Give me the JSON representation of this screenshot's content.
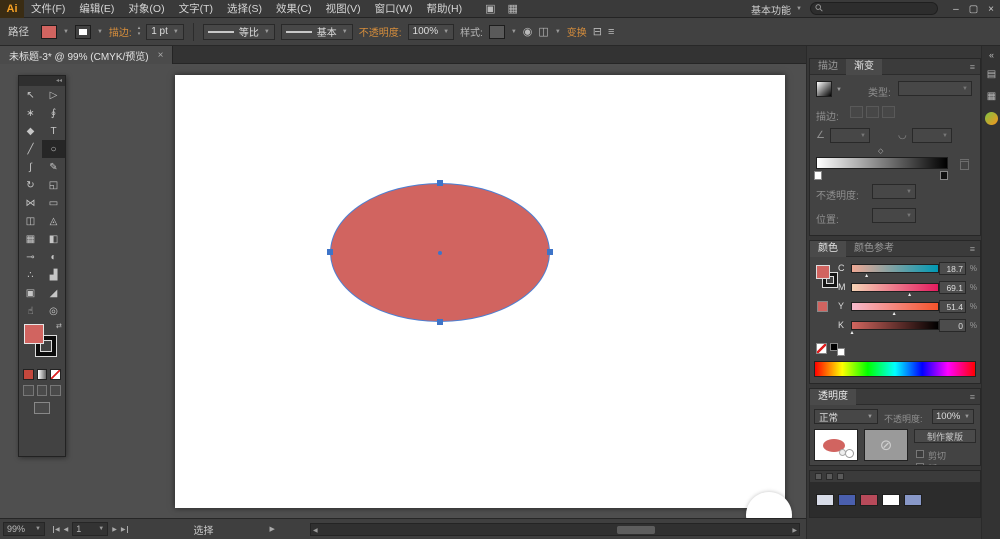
{
  "colors": {
    "accent": "#d78e3c",
    "canvas_gray": "#4f4f4f"
  },
  "canvas": {
    "ellipse": {
      "fill": "#d16460",
      "stroke": "#4d7fd2"
    }
  },
  "ui": {
    "caret": "▼",
    "caret_up": "▴",
    "caret_down": "▾",
    "collapse": "◂◂",
    "expand": "«",
    "panel_menu": "≡",
    "arrow_left": "◀",
    "arrow_right": "▶",
    "swap": "⇄",
    "diamond": "◇",
    "blocked": "⊘"
  },
  "menubar": {
    "logo": "Ai",
    "menus": [
      "文件(F)",
      "编辑(E)",
      "对象(O)",
      "文字(T)",
      "选择(S)",
      "效果(C)",
      "视图(V)",
      "窗口(W)",
      "帮助(H)"
    ],
    "app_icons": [
      {
        "name": "bridge-icon",
        "glyph": "▣"
      },
      {
        "name": "arrange-documents-icon",
        "glyph": "▦"
      }
    ],
    "workspace_label": "基本功能",
    "search_icon": "⚲",
    "window_controls": [
      {
        "name": "minimize-button",
        "glyph": "–"
      },
      {
        "name": "restore-button",
        "glyph": "▢"
      },
      {
        "name": "close-button",
        "glyph": "×"
      }
    ]
  },
  "controlbar": {
    "object_type": "路径",
    "stroke_label": "描边:",
    "stroke_width": "1 pt",
    "width_profile_label": "等比",
    "brush_label": "基本",
    "opacity_label": "不透明度:",
    "opacity_value": "100%",
    "style_label": "样式:",
    "transform_label": "变换",
    "icons": [
      {
        "name": "recolor-artwork-icon",
        "glyph": "◉"
      },
      {
        "name": "align-icon",
        "glyph": "◫"
      },
      {
        "name": "arrange-icon",
        "glyph": "⊟"
      },
      {
        "name": "options-icon",
        "glyph": "≡"
      }
    ]
  },
  "tabbar": {
    "title": "未标题-3* @ 99% (CMYK/预览)",
    "close_icon": "×"
  },
  "toolbar": {
    "tools": [
      {
        "name": "selection-tool",
        "glyph": "↖"
      },
      {
        "name": "direct-selection-tool",
        "glyph": "▷"
      },
      {
        "name": "magic-wand-tool",
        "glyph": "∗"
      },
      {
        "name": "lasso-tool",
        "glyph": "∮"
      },
      {
        "name": "pen-tool",
        "glyph": "◆"
      },
      {
        "name": "type-tool",
        "glyph": "T"
      },
      {
        "name": "line-tool",
        "glyph": "╱"
      },
      {
        "name": "ellipse-tool",
        "glyph": "○",
        "bg": "#262626"
      },
      {
        "name": "paintbrush-tool",
        "glyph": "∫"
      },
      {
        "name": "pencil-tool",
        "glyph": "✎"
      },
      {
        "name": "rotate-tool",
        "glyph": "↻"
      },
      {
        "name": "scale-tool",
        "glyph": "◱"
      },
      {
        "name": "width-tool",
        "glyph": "⋈"
      },
      {
        "name": "free-transform-tool",
        "glyph": "▭"
      },
      {
        "name": "shape-builder-tool",
        "glyph": "◫"
      },
      {
        "name": "perspective-grid-tool",
        "glyph": "◬"
      },
      {
        "name": "mesh-tool",
        "glyph": "▦"
      },
      {
        "name": "gradient-tool",
        "glyph": "◧"
      },
      {
        "name": "eyedropper-tool",
        "glyph": "⊸"
      },
      {
        "name": "blend-tool",
        "glyph": "◐"
      },
      {
        "name": "symbol-sprayer-tool",
        "glyph": "∴"
      },
      {
        "name": "column-graph-tool",
        "glyph": "▟"
      },
      {
        "name": "artboard-tool",
        "glyph": "▣"
      },
      {
        "name": "slice-tool",
        "glyph": "◢"
      },
      {
        "name": "hand-tool",
        "glyph": "☝"
      },
      {
        "name": "zoom-tool",
        "glyph": "◎"
      }
    ]
  },
  "panels": {
    "gradient": {
      "tab_stroke": "描边",
      "tab_gradient": "渐变",
      "type_label": "类型:",
      "stroke_label": "描边:",
      "angle_icon": "∠",
      "aspect_icon": "◡",
      "opacity_label": "不透明度:",
      "location_label": "位置:"
    },
    "color": {
      "tab_color": "颜色",
      "tab_guide": "颜色参考",
      "unit": "%",
      "sliders": [
        {
          "channel": "C",
          "value": "18.7",
          "pos": "19%",
          "from": "#efa995",
          "to": "#0099b4"
        },
        {
          "channel": "M",
          "value": "69.1",
          "pos": "69%",
          "from": "#f6d3b5",
          "to": "#e31c5f"
        },
        {
          "channel": "Y",
          "value": "51.4",
          "pos": "51%",
          "from": "#f5b9cb",
          "to": "#f4532b"
        },
        {
          "channel": "K",
          "value": "0",
          "pos": "2%",
          "from": "#d1655e",
          "to": "#000000"
        }
      ]
    },
    "transparency": {
      "title": "透明度",
      "blend_mode": "正常",
      "opacity_label": "不透明度:",
      "opacity_value": "100%",
      "make_mask_label": "制作蒙版",
      "clip_label": "剪切",
      "invert_label": "版"
    },
    "library_chips": [
      "#d8dce8",
      "#4a5fae",
      "#b84a5a",
      "#ffffff",
      "#8898c8"
    ]
  },
  "dock_icons": {
    "icons": [
      {
        "name": "color-panel-icon",
        "glyph": "▤"
      },
      {
        "name": "swatches-panel-icon",
        "glyph": "▦"
      }
    ],
    "color_guide": {
      "c1": "#7ec242",
      "c2": "#f7941d"
    }
  },
  "statusbar": {
    "zoom": "99%",
    "artboard_number": "1",
    "status_label": "选择"
  }
}
